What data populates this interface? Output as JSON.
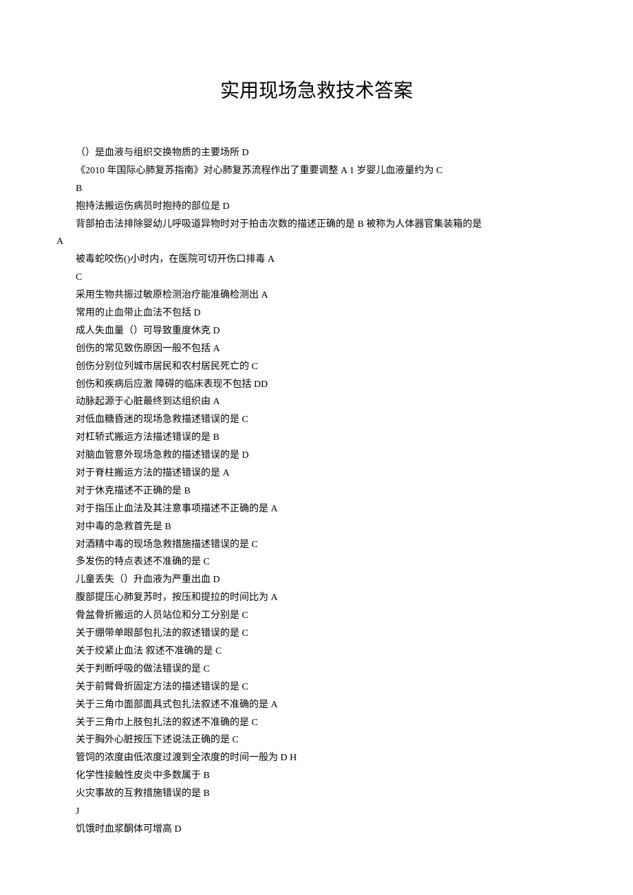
{
  "title": "实用现场急救技术答案",
  "lines": [
    {
      "text": "（）是血液与组织交换物质的主要场所 D",
      "outdent": false
    },
    {
      "text": "《2010 年国际心肺复苏指南》对心肺复苏流程作出了重要调整 A 1 岁婴儿血液量约为 C",
      "outdent": false
    },
    {
      "text": "B",
      "outdent": false
    },
    {
      "text": "抱持法搬运伤病员时抱持的部位是 D",
      "outdent": false
    },
    {
      "text": "背部拍击法排除婴幼儿呼吸道异物时对于拍击次数的描述正确的是 B  被称为人体器官集装箱的是",
      "outdent": false
    },
    {
      "text": "A",
      "outdent": true
    },
    {
      "text": "被毒蛇咬伤()小时内，在医院可切开伤口排毒 A",
      "outdent": false
    },
    {
      "text": "C",
      "outdent": false
    },
    {
      "text": "采用生物共振过敏原检测治疗能准确检测出 A",
      "outdent": false
    },
    {
      "text": "常用的止血带止血法不包括 D",
      "outdent": false
    },
    {
      "text": "成人失血量（）可导致重度休克 D",
      "outdent": false
    },
    {
      "text": "创伤的常见致伤原因一般不包括 A",
      "outdent": false
    },
    {
      "text": "创伤分别位列城市居民和农村居民死亡的 C",
      "outdent": false
    },
    {
      "text": "创伤和疾病后应激  障碍的临床表现不包括 DD",
      "outdent": false
    },
    {
      "text": "动脉起源于心脏最终到达组织由 A",
      "outdent": false
    },
    {
      "text": "对低血糖昏迷的现场急救描述错误的是 C",
      "outdent": false
    },
    {
      "text": "对杠轿式搬运方法描述错误的是 B",
      "outdent": false
    },
    {
      "text": "对脑血管意外现场急救的描述错误的是 D",
      "outdent": false
    },
    {
      "text": "对于脊柱搬运方法的描述错误的是 A",
      "outdent": false
    },
    {
      "text": "对于休克描述不正确的是 B",
      "outdent": false
    },
    {
      "text": "对于指压止血法及其注意事项描述不正确的是 A",
      "outdent": false
    },
    {
      "text": "对中毒的急救首先是 B",
      "outdent": false
    },
    {
      "text": "对酒精中毒的现场急救措施描述错误的是 C",
      "outdent": false
    },
    {
      "text": "多发伤的特点表述不准确的是 C",
      "outdent": false
    },
    {
      "text": "儿童丢失（）升血液为严重出血 D",
      "outdent": false
    },
    {
      "text": "腹部提压心肺复苏时，按压和提拉的时间比为 A",
      "outdent": false
    },
    {
      "text": "骨盆骨折搬运的人员站位和分工分别是 C",
      "outdent": false
    },
    {
      "text": "关于绷带单眼部包扎法的叙述错误的是 C",
      "outdent": false
    },
    {
      "text": "关于绞紧止血法  叙述不准确的是 C",
      "outdent": false
    },
    {
      "text": "关于判断呼吸的做法错误的是 C",
      "outdent": false
    },
    {
      "text": "关于前臂骨折固定方法的描述错误的是 C",
      "outdent": false
    },
    {
      "text": "关于三角巾面部面具式包扎法叙述不准确的是 A",
      "outdent": false
    },
    {
      "text": "关于三角巾上肢包扎法的叙述不准确的是 C",
      "outdent": false
    },
    {
      "text": "关于胸外心脏按压下述说法正确的是 C",
      "outdent": false
    },
    {
      "text": "管饲的浓度由低浓度过渡到全浓度的时间一般为 D H",
      "outdent": false
    },
    {
      "text": "化学性接触性皮炎中多数属于 B",
      "outdent": false
    },
    {
      "text": "火灾事故的互救措施错误的是 B",
      "outdent": false
    },
    {
      "text": "J",
      "outdent": false
    },
    {
      "text": "饥饿时血浆酮体可增高 D",
      "outdent": false
    }
  ]
}
